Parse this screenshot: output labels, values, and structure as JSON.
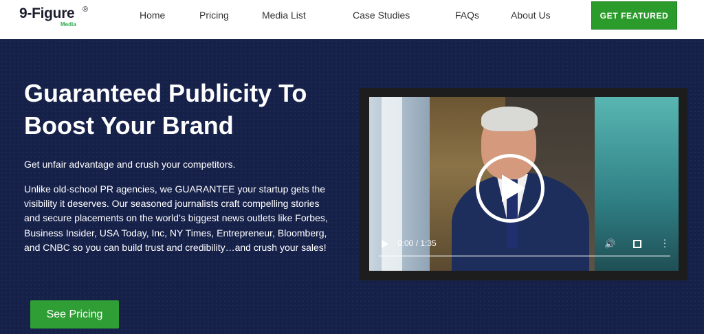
{
  "header": {
    "logo_text": "9-Figure",
    "logo_reg": "®",
    "logo_sub": "Media",
    "nav": [
      "Home",
      "Pricing",
      "Media List",
      "Case Studies",
      "FAQs",
      "About Us"
    ],
    "cta_label": "GET FEATURED"
  },
  "hero": {
    "title_line1": "Guaranteed Publicity To",
    "title_line2": "Boost Your Brand",
    "tagline": "Get unfair advantage and crush your competitors.",
    "body": "Unlike old-school PR agencies, we GUARANTEE your startup gets the visibility it deserves. Our seasoned journalists craft compelling stories and secure placements on the world’s biggest news outlets like Forbes, Business Insider, USA Today, Inc, NY Times, Entrepreneur, Bloomberg, and CNBC so you can build trust and credibility…and crush your sales!",
    "pricing_button": "See Pricing"
  },
  "video": {
    "time": "0:00 / 1:35",
    "progress_fraction": 0.0
  },
  "colors": {
    "accent_green": "#2b9c2b",
    "hero_bg": "#16214a"
  },
  "icons": {
    "play": "play-icon",
    "volume": "volume-icon",
    "fullscreen": "fullscreen-icon",
    "more": "more-vertical-icon"
  }
}
